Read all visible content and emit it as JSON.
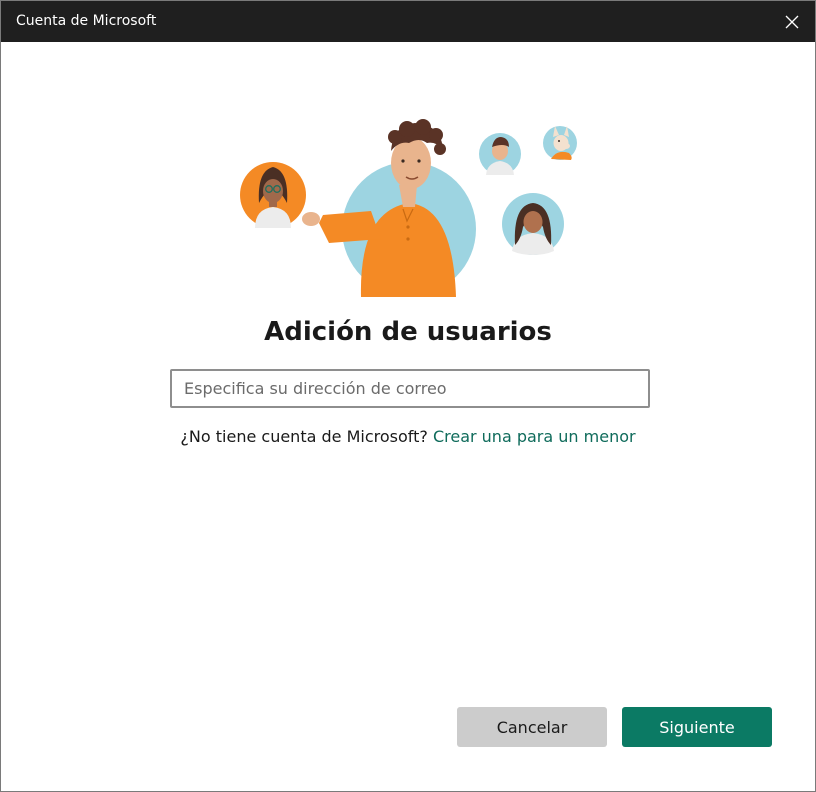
{
  "window": {
    "title": "Cuenta de Microsoft"
  },
  "main": {
    "heading": "Adición de usuarios",
    "email_placeholder": "Especifica su dirección de correo",
    "email_value": "",
    "no_account_text": "¿No tiene cuenta de Microsoft? ",
    "create_child_link": "Crear una para un menor"
  },
  "footer": {
    "cancel_label": "Cancelar",
    "next_label": "Siguiente"
  },
  "colors": {
    "titlebar": "#1f1f1f",
    "accent": "#0b7a64",
    "link": "#0f6b5b",
    "illustration_orange": "#f48a25",
    "illustration_blue": "#9dd4e1"
  },
  "icons": {
    "close": "close-icon",
    "illustration": "add-users-illustration"
  }
}
